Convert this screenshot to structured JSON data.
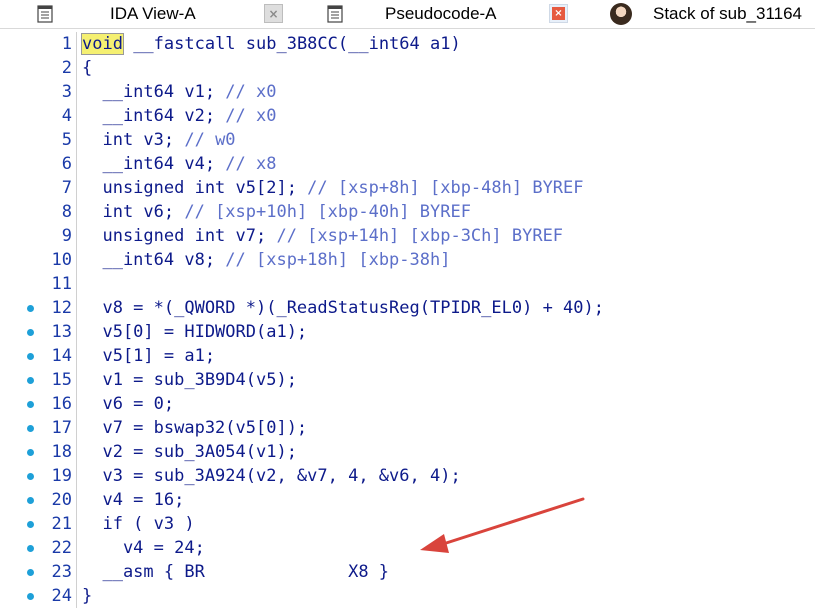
{
  "tabs": [
    {
      "title": "IDA View-A",
      "close_label": "×",
      "icon": "document-icon"
    },
    {
      "title": "Pseudocode-A",
      "close_label": "×",
      "icon": "document-icon"
    },
    {
      "title": "Stack of sub_31164",
      "icon": "avatar-icon"
    }
  ],
  "code_lines": [
    {
      "num": "1",
      "dot": false,
      "code": "void __fastcall sub_3B8CC(__int64 a1)"
    },
    {
      "num": "2",
      "dot": false,
      "code": "{"
    },
    {
      "num": "3",
      "dot": false,
      "code": "  __int64 v1; // x0"
    },
    {
      "num": "4",
      "dot": false,
      "code": "  __int64 v2; // x0"
    },
    {
      "num": "5",
      "dot": false,
      "code": "  int v3; // w0"
    },
    {
      "num": "6",
      "dot": false,
      "code": "  __int64 v4; // x8"
    },
    {
      "num": "7",
      "dot": false,
      "code": "  unsigned int v5[2]; // [xsp+8h] [xbp-48h] BYREF"
    },
    {
      "num": "8",
      "dot": false,
      "code": "  int v6; // [xsp+10h] [xbp-40h] BYREF"
    },
    {
      "num": "9",
      "dot": false,
      "code": "  unsigned int v7; // [xsp+14h] [xbp-3Ch] BYREF"
    },
    {
      "num": "10",
      "dot": false,
      "code": "  __int64 v8; // [xsp+18h] [xbp-38h]"
    },
    {
      "num": "11",
      "dot": false,
      "code": ""
    },
    {
      "num": "12",
      "dot": true,
      "code": "  v8 = *(_QWORD *)(_ReadStatusReg(TPIDR_EL0) + 40);"
    },
    {
      "num": "13",
      "dot": true,
      "code": "  v5[0] = HIDWORD(a1);"
    },
    {
      "num": "14",
      "dot": true,
      "code": "  v5[1] = a1;"
    },
    {
      "num": "15",
      "dot": true,
      "code": "  v1 = sub_3B9D4(v5);"
    },
    {
      "num": "16",
      "dot": true,
      "code": "  v6 = 0;"
    },
    {
      "num": "17",
      "dot": true,
      "code": "  v7 = bswap32(v5[0]);"
    },
    {
      "num": "18",
      "dot": true,
      "code": "  v2 = sub_3A054(v1);"
    },
    {
      "num": "19",
      "dot": true,
      "code": "  v3 = sub_3A924(v2, &v7, 4, &v6, 4);"
    },
    {
      "num": "20",
      "dot": true,
      "code": "  v4 = 16;"
    },
    {
      "num": "21",
      "dot": true,
      "code": "  if ( v3 )"
    },
    {
      "num": "22",
      "dot": true,
      "code": "    v4 = 24;"
    },
    {
      "num": "23",
      "dot": true,
      "code": "  __asm { BR              X8 }"
    },
    {
      "num": "24",
      "dot": true,
      "code": "}"
    }
  ],
  "colors": {
    "keyword": "#0d1a8a",
    "comment": "#5c6fc9",
    "line_number": "#1a3aa8",
    "breakpoint_dot": "#1ea0d8",
    "highlight": "#f5f071",
    "annotation_arrow": "#d9443c"
  }
}
